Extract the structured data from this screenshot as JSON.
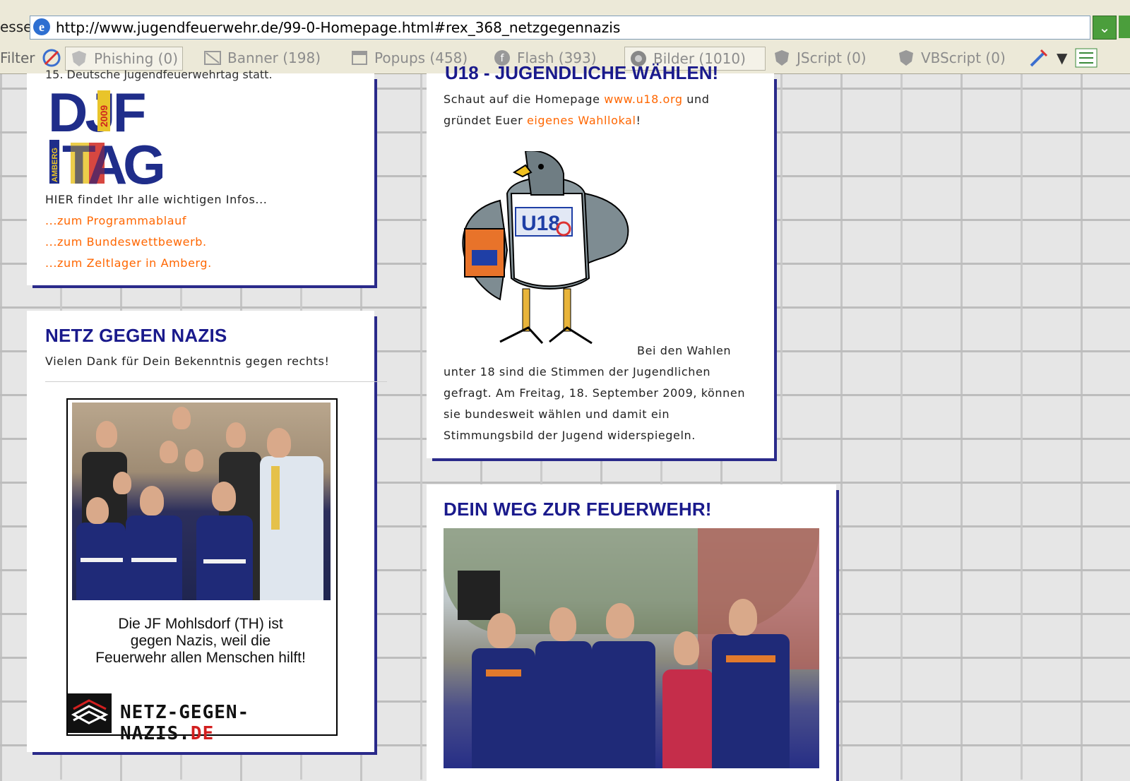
{
  "browser": {
    "address_label": "esse",
    "url": "http://www.jugendfeuerwehr.de/99-0-Homepage.html#rex_368_netzgegennazis",
    "filter_label": "Filter",
    "filters": [
      {
        "name": "phishing",
        "label": "Phishing (0)",
        "icon": "shield-icon"
      },
      {
        "name": "banner",
        "label": "Banner (198)",
        "icon": "banner-icon"
      },
      {
        "name": "popups",
        "label": "Popups (458)",
        "icon": "popup-icon"
      },
      {
        "name": "flash",
        "label": "Flash (393)",
        "icon": "flash-icon"
      },
      {
        "name": "bilder",
        "label": "Bilder (1010)",
        "icon": "image-icon"
      },
      {
        "name": "jscript",
        "label": "JScript (0)",
        "icon": "jscript-icon"
      },
      {
        "name": "vbscript",
        "label": "VBScript (0)",
        "icon": "vbscript-icon"
      }
    ]
  },
  "djf": {
    "cut_text": "15. Deutsche Jugendfeuerwehrtag statt.",
    "logo_top": "DJF",
    "logo_bottom": "TAG",
    "logo_year": "2009",
    "logo_side": "AMBERG",
    "info": "HIER findet Ihr alle wichtigen Infos...",
    "links": [
      "...zum Programmablauf",
      "...zum Bundeswettbewerb.",
      "...zum Zeltlager in Amberg."
    ]
  },
  "ngn": {
    "title": "NETZ GEGEN NAZIS",
    "thanks": "Vielen Dank für Dein Bekenntnis gegen rechts!",
    "caption": [
      "Die JF Mohlsdorf (TH) ist",
      "gegen Nazis, weil die",
      "Feuerwehr allen Menschen hilft!"
    ],
    "logo_text": "NETZ-GEGEN-NAZIS.",
    "logo_de": "DE"
  },
  "u18": {
    "cut_title": "U18 - JUGENDLICHE WÄHLEN!",
    "intro_pre": "Schaut auf die Homepage ",
    "intro_link": "www.u18.org",
    "intro_mid": " und",
    "intro_line2_pre": "gründet Euer ",
    "intro_line2_link": "eigenes Wahllokal",
    "intro_line2_post": "!",
    "shirt_text": "U18",
    "body_first": "Bei den Wahlen",
    "body_lines": [
      "unter 18 sind die Stimmen der Jugendlichen",
      "gefragt. Am Freitag, 18. September 2009, können",
      "sie bundesweit wählen und damit ein",
      "Stimmungsbild der Jugend widerspiegeln."
    ]
  },
  "weg": {
    "title": "DEIN WEG ZUR FEUERWEHR!"
  },
  "colors": {
    "title_blue": "#1a1a8c",
    "link_orange": "#ff6600",
    "box_shadow": "#2a2a8a"
  }
}
